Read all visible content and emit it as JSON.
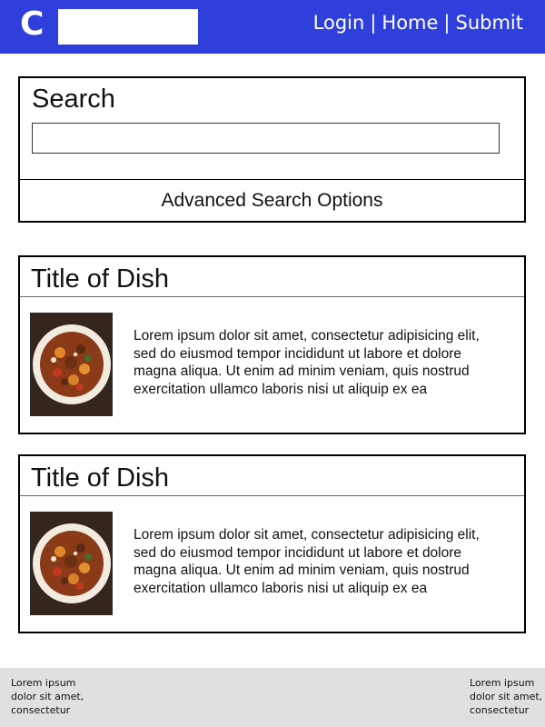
{
  "header": {
    "logo": "C",
    "search_value": "",
    "nav": [
      {
        "label": "Login"
      },
      {
        "label": "Home"
      },
      {
        "label": "Submit"
      }
    ],
    "separator": "|",
    "background": "#2f3fdc"
  },
  "search": {
    "title": "Search",
    "input_value": "",
    "advanced_label": "Advanced Search Options"
  },
  "dishes": [
    {
      "title": "Title of Dish",
      "image_icon": "stew-bowl-image",
      "description": "Lorem ipsum dolor sit amet, consectetur adipisicing elit, sed do eiusmod tempor incididunt ut labore et dolore magna aliqua. Ut enim ad minim veniam, quis nostrud exercitation ullamco laboris nisi ut aliquip ex ea"
    },
    {
      "title": "Title of Dish",
      "image_icon": "stew-bowl-image",
      "description": "Lorem ipsum dolor sit amet, consectetur adipisicing elit, sed do eiusmod tempor incididunt ut labore et dolore magna aliqua. Ut enim ad minim veniam, quis nostrud exercitation ullamco laboris nisi ut aliquip ex ea"
    }
  ],
  "footer": {
    "left_text": "Lorem ipsum dolor sit amet, consectetur",
    "right_text": "Lorem ipsum dolor sit amet, consectetur"
  }
}
